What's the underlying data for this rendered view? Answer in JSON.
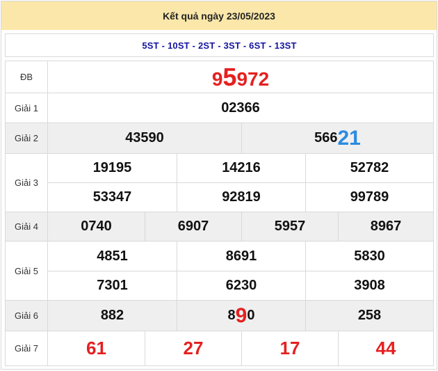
{
  "header": {
    "title": "Kết quả ngày 23/05/2023"
  },
  "codes": "5ST - 10ST - 2ST - 3ST - 6ST - 13ST",
  "prizes": {
    "db": {
      "label": "ĐB",
      "prefix": "9",
      "highlight": "5",
      "suffix": "972"
    },
    "g1": {
      "label": "Giải 1",
      "values": [
        "02366"
      ]
    },
    "g2": {
      "label": "Giải 2",
      "values": [
        "43590"
      ],
      "v2_prefix": "566",
      "v2_highlight": "21"
    },
    "g3": {
      "label": "Giải 3",
      "values": [
        "19195",
        "14216",
        "52782",
        "53347",
        "92819",
        "99789"
      ]
    },
    "g4": {
      "label": "Giải 4",
      "values": [
        "0740",
        "6907",
        "5957",
        "8967"
      ]
    },
    "g5": {
      "label": "Giải 5",
      "values": [
        "4851",
        "8691",
        "5830",
        "7301",
        "6230",
        "3908"
      ]
    },
    "g6": {
      "label": "Giải 6",
      "values": [
        "882",
        "258"
      ],
      "v2_prefix": "8",
      "v2_highlight": "9",
      "v2_suffix": "0"
    },
    "g7": {
      "label": "Giải 7",
      "values": [
        "61",
        "27",
        "17",
        "44"
      ]
    }
  },
  "colors": {
    "header_bg": "#fbe7a9",
    "code_text": "#1414a0",
    "accent_red": "#e52020",
    "accent_blue": "#2b8be0",
    "alt_row_bg": "#efefef"
  }
}
